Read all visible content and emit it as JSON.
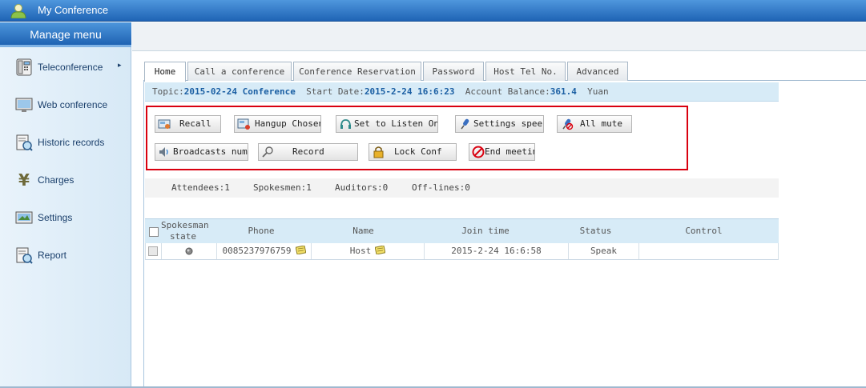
{
  "window": {
    "title": "My Conference"
  },
  "sidebar": {
    "header": "Manage menu",
    "items": [
      {
        "label": "Teleconference",
        "icon": "phone-icon",
        "arrow": "▸"
      },
      {
        "label": "Web conference",
        "icon": "web-conference-icon"
      },
      {
        "label": "Historic records",
        "icon": "history-icon"
      },
      {
        "label": "Charges",
        "icon": "yen-icon"
      },
      {
        "label": "Settings",
        "icon": "settings-icon"
      },
      {
        "label": "Report",
        "icon": "report-icon"
      }
    ]
  },
  "tabs": [
    {
      "label": "Home",
      "active": true
    },
    {
      "label": "Call a conference"
    },
    {
      "label": "Conference Reservation"
    },
    {
      "label": "Password"
    },
    {
      "label": "Host Tel No."
    },
    {
      "label": "Advanced"
    }
  ],
  "info": {
    "topic_label": "Topic:",
    "topic": "2015-02-24 Conference",
    "start_label": "Start Date:",
    "start": "2015-2-24 16:6:23",
    "balance_label": "Account Balance:",
    "balance": "361.4",
    "currency": "Yuan"
  },
  "actions": {
    "recall": "Recall",
    "hangup": "Hangup Chosen",
    "listen": "Set to Listen Only",
    "speech": "Settings speech",
    "mute": "All mute",
    "broadcast": "Broadcasts number",
    "record": "Record",
    "lock": "Lock Conf",
    "end": "End meeting"
  },
  "stats": {
    "attendees": "Attendees:1",
    "spokesmen": "Spokesmen:1",
    "auditors": "Auditors:0",
    "offlines": "Off-lines:0"
  },
  "table": {
    "headers": {
      "state_line1": "Spokesman",
      "state_line2": "state",
      "phone": "Phone",
      "name": "Name",
      "join": "Join time",
      "status": "Status",
      "control": "Control"
    },
    "rows": [
      {
        "phone": "0085237976759",
        "name": "Host",
        "join": "2015-2-24 16:6:58",
        "status": "Speak",
        "control": ""
      }
    ]
  },
  "colors": {
    "accent": "#1f64b5",
    "highlight_border": "#d9000f",
    "info_bg": "#d7ebf7"
  }
}
